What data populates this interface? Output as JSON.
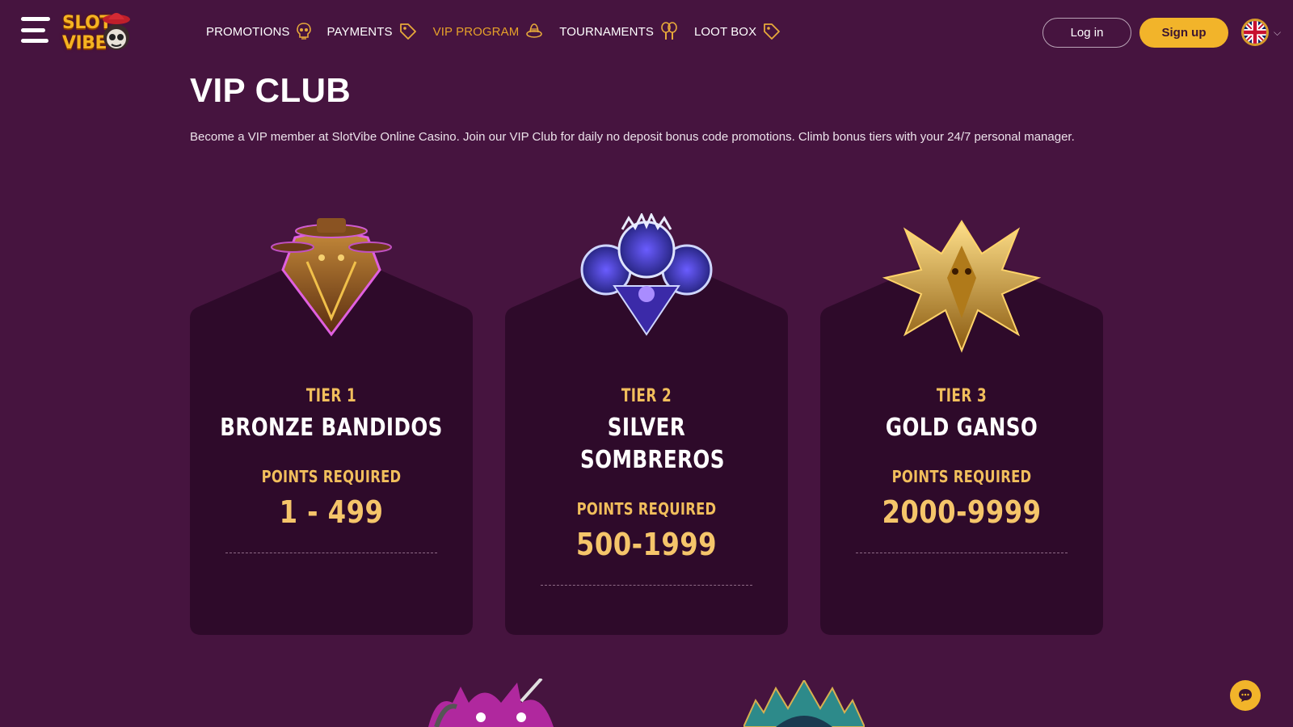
{
  "header": {
    "logo_text_left": "SLOT",
    "logo_text_right": "VIBE",
    "nav": [
      {
        "label": "PROMOTIONS",
        "icon": "skull-icon",
        "active": false
      },
      {
        "label": "PAYMENTS",
        "icon": "tag-icon",
        "active": false
      },
      {
        "label": "VIP PROGRAM",
        "icon": "sombrero-icon",
        "active": true
      },
      {
        "label": "TOURNAMENTS",
        "icon": "maracas-icon",
        "active": false
      },
      {
        "label": "LOOT BOX",
        "icon": "tag-icon",
        "active": false
      }
    ],
    "login_label": "Log in",
    "signup_label": "Sign up",
    "language_icon": "uk-flag-icon"
  },
  "main": {
    "title": "VIP CLUB",
    "intro": "Become a VIP member at SlotVibe Online Casino. Join our VIP Club for daily no deposit bonus code promotions. Climb bonus tiers with your 24/7 personal manager."
  },
  "tiers": [
    {
      "tier": "TIER 1",
      "name": "BRONZE BANDIDOS",
      "points_label": "POINTS REQUIRED",
      "points": "1 - 499",
      "emblem": "bronze-bandidos-emblem"
    },
    {
      "tier": "TIER 2",
      "name": "SILVER SOMBREROS",
      "points_label": "POINTS REQUIRED",
      "points": "500-1999",
      "emblem": "silver-sombreros-emblem"
    },
    {
      "tier": "TIER 3",
      "name": "GOLD GANSO",
      "points_label": "POINTS REQUIRED",
      "points": "2000-9999",
      "emblem": "gold-ganso-emblem"
    }
  ],
  "colors": {
    "background": "#46143f",
    "card": "#2e0a2a",
    "accent_gold": "#f2b42a",
    "tier_text": "#f1be5c"
  },
  "chat_icon": "chat-icon"
}
